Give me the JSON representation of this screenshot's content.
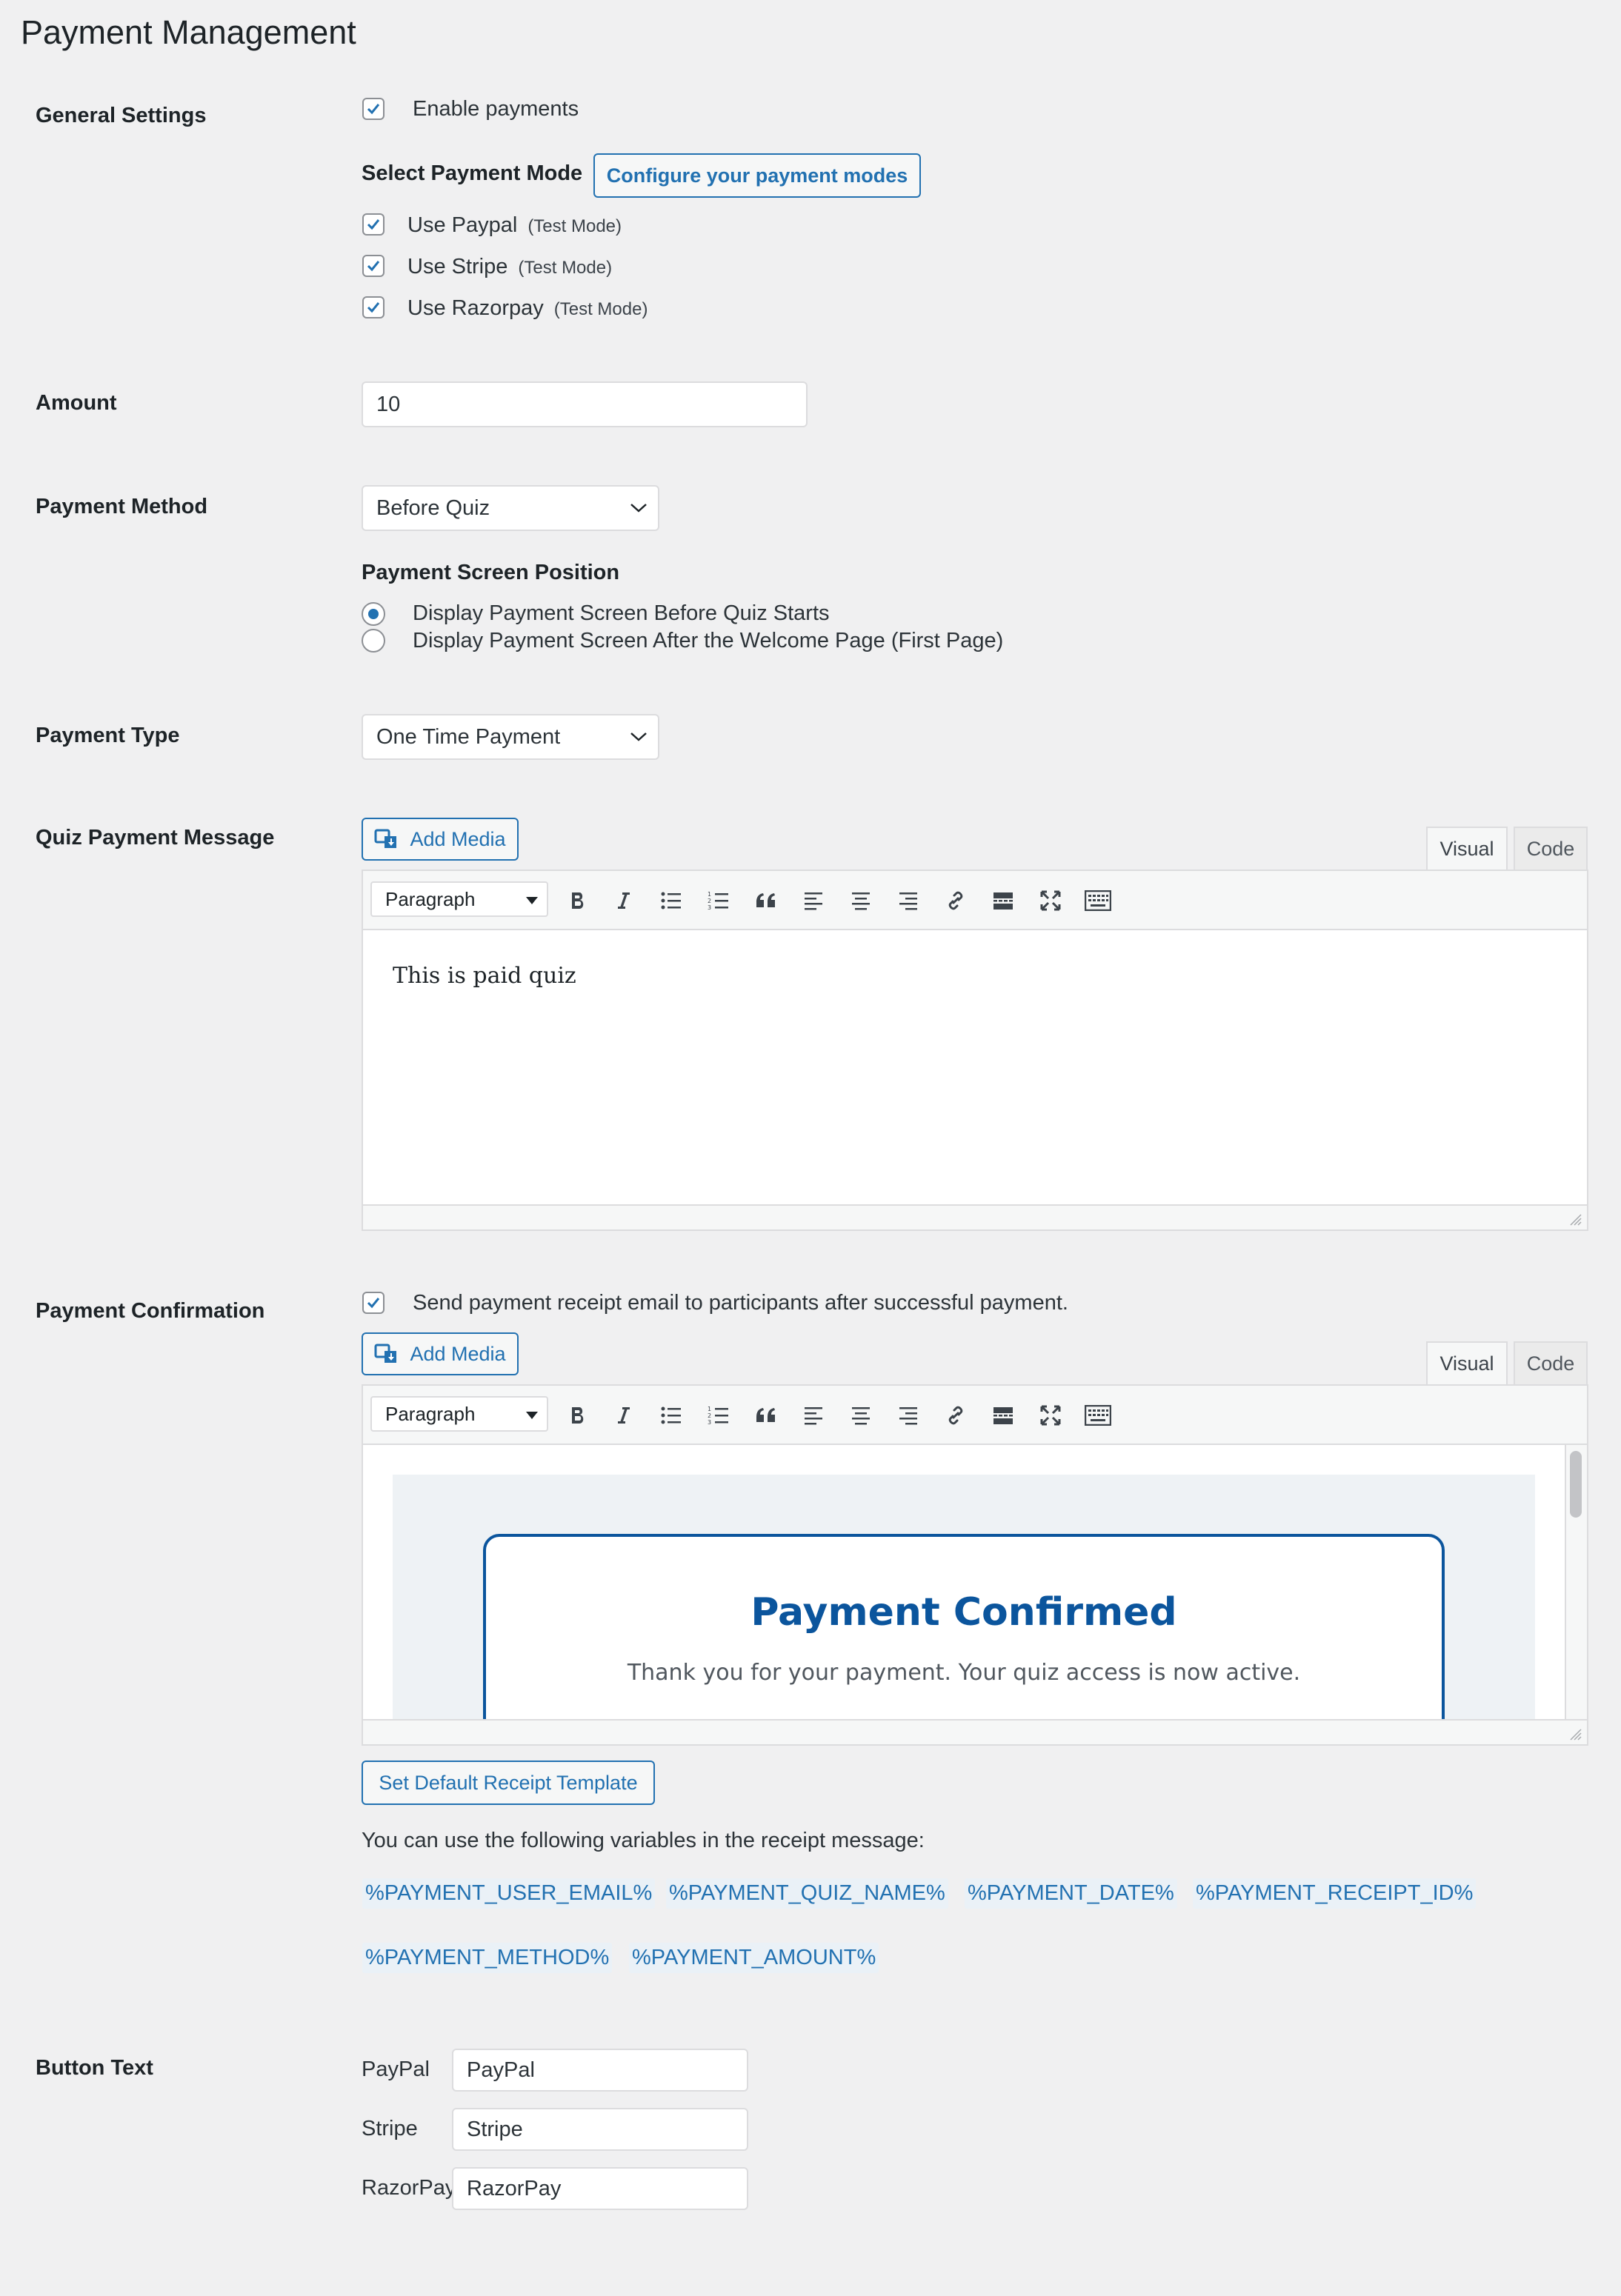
{
  "page": {
    "title": "Payment Management"
  },
  "general": {
    "label": "General Settings",
    "enable_payments": "Enable payments",
    "select_mode_label": "Select Payment Mode",
    "configure_button": "Configure your payment modes",
    "modes": [
      {
        "label": "Use Paypal",
        "note": "(Test Mode)",
        "checked": true
      },
      {
        "label": "Use Stripe",
        "note": "(Test Mode)",
        "checked": true
      },
      {
        "label": "Use Razorpay",
        "note": "(Test Mode)",
        "checked": true
      }
    ]
  },
  "amount": {
    "label": "Amount",
    "value": "10"
  },
  "payment_method": {
    "label": "Payment Method",
    "selected": "Before Quiz",
    "screen_position_label": "Payment Screen Position",
    "options": [
      {
        "label": "Display Payment Screen Before Quiz Starts",
        "selected": true
      },
      {
        "label": "Display Payment Screen After the Welcome Page (First Page)",
        "selected": false
      }
    ]
  },
  "payment_type": {
    "label": "Payment Type",
    "selected": "One Time Payment"
  },
  "quiz_message": {
    "label": "Quiz Payment Message",
    "add_media": "Add Media",
    "tab_visual": "Visual",
    "tab_code": "Code",
    "format": "Paragraph",
    "content": "This is paid quiz"
  },
  "confirmation": {
    "label": "Payment Confirmation",
    "send_receipt": "Send payment receipt email to participants after successful payment.",
    "add_media": "Add Media",
    "tab_visual": "Visual",
    "tab_code": "Code",
    "format": "Paragraph",
    "preview_title": "Payment Confirmed",
    "preview_text": "Thank you for your payment. Your quiz access is now active.",
    "default_template_button": "Set Default Receipt Template",
    "variables_hint": "You can use the following variables in the receipt message:",
    "variables": [
      "%PAYMENT_USER_EMAIL%",
      "%PAYMENT_QUIZ_NAME%",
      "%PAYMENT_DATE%",
      "%PAYMENT_RECEIPT_ID%",
      "%PAYMENT_METHOD%",
      "%PAYMENT_AMOUNT%"
    ]
  },
  "button_text": {
    "label": "Button Text",
    "rows": [
      {
        "label": "PayPal",
        "value": "PayPal"
      },
      {
        "label": "Stripe",
        "value": "Stripe"
      },
      {
        "label": "RazorPay",
        "value": "RazorPay"
      }
    ]
  },
  "colors": {
    "accent": "#2271b1",
    "preview_title": "#0b559d",
    "background": "#f0f0f1"
  }
}
